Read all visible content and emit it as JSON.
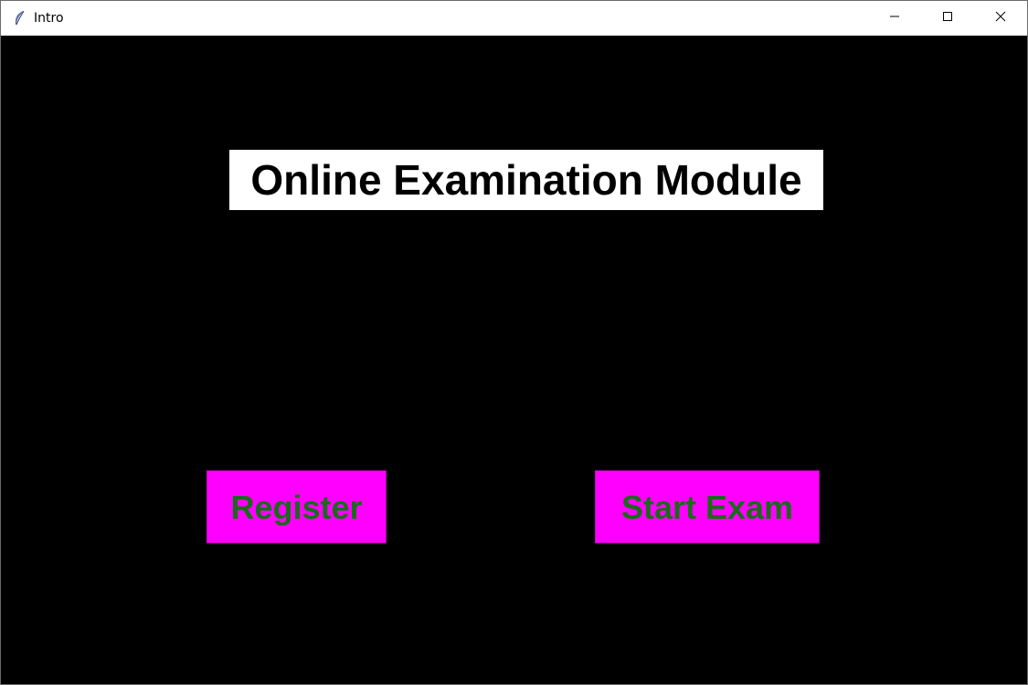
{
  "window": {
    "title": "Intro",
    "icons": {
      "app": "feather-icon",
      "minimize": "minimize-icon",
      "maximize": "maximize-icon",
      "close": "close-icon"
    }
  },
  "main": {
    "heading": "Online Examination Module",
    "register_label": "Register",
    "start_exam_label": "Start Exam"
  },
  "colors": {
    "background": "#000000",
    "heading_background": "#ffffff",
    "button_background": "#ff00ff",
    "button_text": "#1b6a1b"
  }
}
